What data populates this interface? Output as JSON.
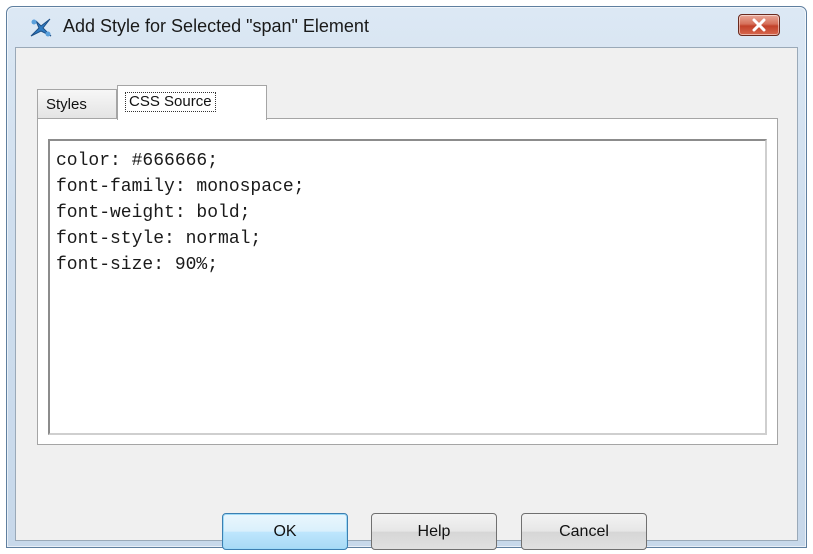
{
  "window": {
    "title": "Add Style for Selected \"span\" Element"
  },
  "tabs": [
    {
      "label": "Styles",
      "selected": false
    },
    {
      "label": "CSS Source",
      "selected": true
    }
  ],
  "editor": {
    "lines": [
      "color: #666666;",
      "font-family: monospace;",
      "font-weight: bold;",
      "font-style: normal;",
      "font-size: 90%;"
    ]
  },
  "buttons": {
    "ok": "OK",
    "help": "Help",
    "cancel": "Cancel"
  },
  "colors": {
    "close_button": "#c2412a",
    "default_button_border": "#3c7fb1"
  },
  "icons": {
    "title": "xml-editor-app-icon",
    "close": "close-icon"
  }
}
